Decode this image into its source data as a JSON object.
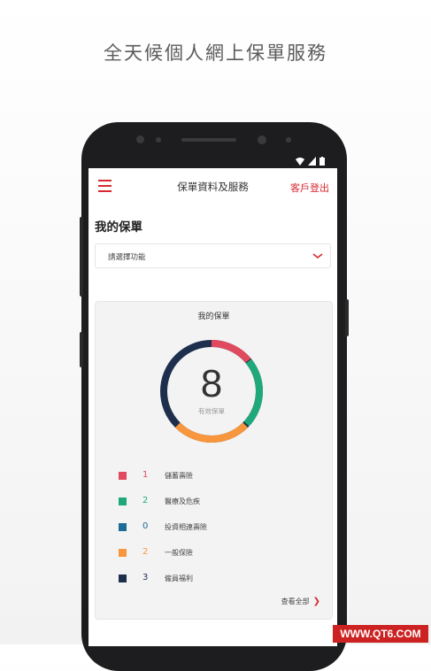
{
  "headline": "全天候個人網上保單服務",
  "appbar": {
    "title": "保單資料及服務",
    "logout_label": "客戶登出"
  },
  "page_title": "我的保單",
  "select": {
    "label": "請選擇功能"
  },
  "card": {
    "title": "我的保單",
    "total": "8",
    "total_label": "有效保單",
    "legend": [
      {
        "count": "1",
        "name": "儲蓄壽險",
        "color": "#e04a5f"
      },
      {
        "count": "2",
        "name": "醫療及危疾",
        "color": "#1fa97a"
      },
      {
        "count": "0",
        "name": "投資相連壽險",
        "color": "#1b6c96"
      },
      {
        "count": "2",
        "name": "一般保險",
        "color": "#f7963c"
      },
      {
        "count": "3",
        "name": "僱員福利",
        "color": "#1e2f4d"
      }
    ],
    "view_all": "查看全部"
  },
  "watermark": "WWW.QT6.COM"
}
